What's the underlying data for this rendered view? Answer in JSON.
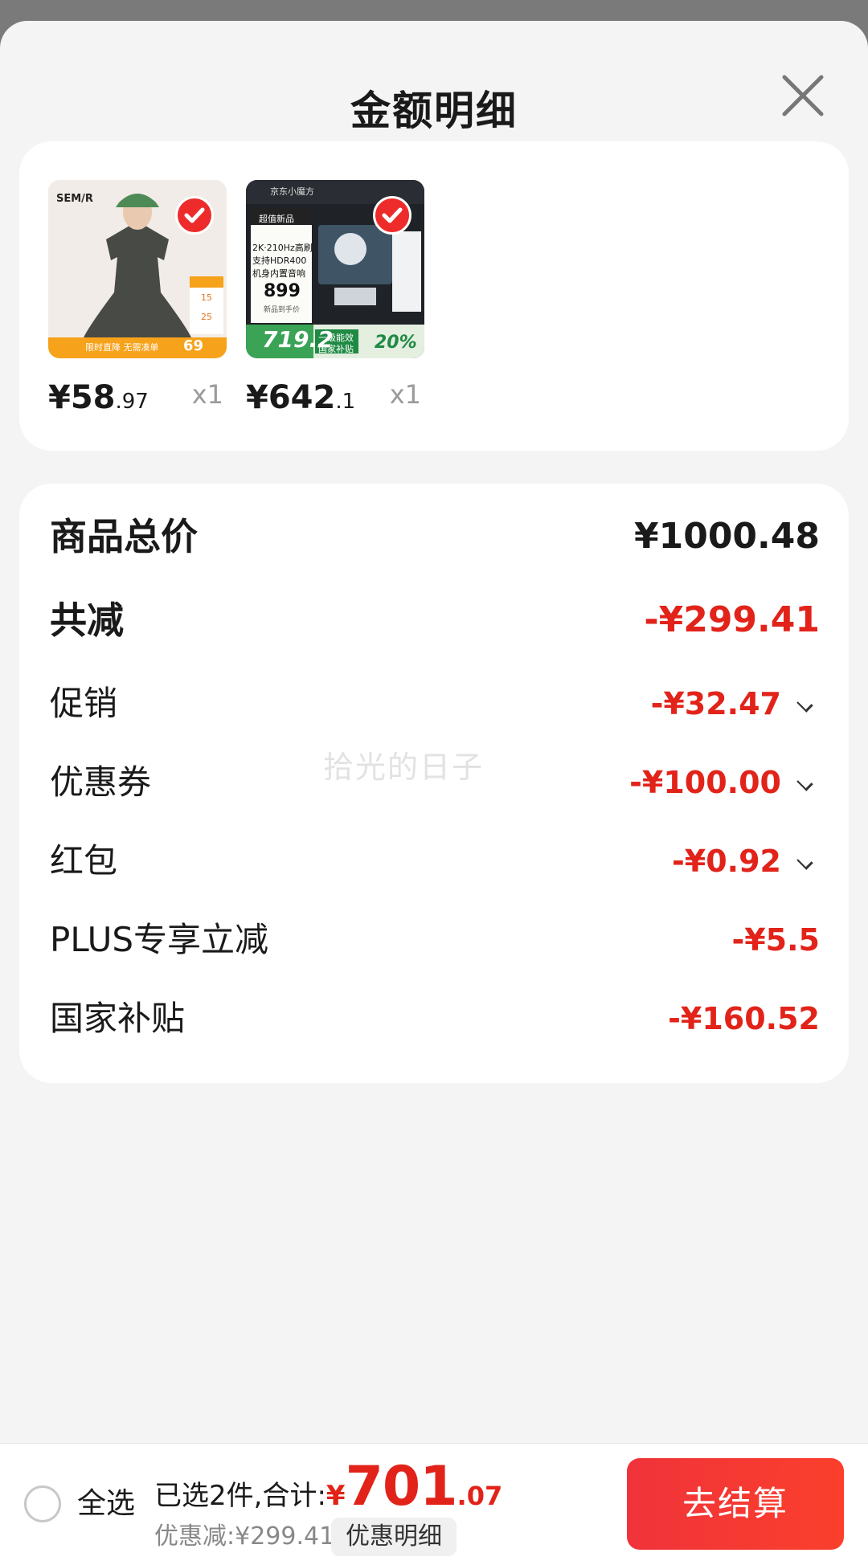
{
  "header": {
    "title": "金额明细",
    "close_icon": "close-icon"
  },
  "products": [
    {
      "name": "dress",
      "price_main": "¥58",
      "price_cents": ".97",
      "qty": "x1",
      "selected": true,
      "image": {
        "brand": "SEM/R",
        "strip_text": "限时直降 无需凑单",
        "strip_number": "69",
        "side_a": "15",
        "side_b": "25"
      }
    },
    {
      "name": "monitor",
      "price_main": "¥642",
      "price_cents": ".1",
      "qty": "x1",
      "selected": true,
      "image": {
        "brand": "京东小魔方",
        "tag": "超值新品",
        "spec1": "2K·210Hz高刷",
        "spec2": "支持HDR400",
        "spec3": "机身内置音响",
        "price_label": "899",
        "price_sub": "新品到手价",
        "big_price": "719.2",
        "badge_top": "一级能效",
        "badge_bottom": "国家补贴",
        "percent": "20%"
      }
    }
  ],
  "summary": {
    "total_label": "商品总价",
    "total_value": "¥1000.48",
    "reduce_label": "共减",
    "reduce_value": "-¥299.41",
    "items": [
      {
        "label": "促销",
        "value": "-¥32.47",
        "expandable": true
      },
      {
        "label": "优惠券",
        "value": "-¥100.00",
        "expandable": true
      },
      {
        "label": "红包",
        "value": "-¥0.92",
        "expandable": true
      },
      {
        "label": "PLUS专享立减",
        "value": "-¥5.5",
        "expandable": false
      },
      {
        "label": "国家补贴",
        "value": "-¥160.52",
        "expandable": false
      }
    ]
  },
  "watermark": "拾光的日子",
  "bottom_bar": {
    "select_all": "全选",
    "selected_text": "已选2件,合计:",
    "currency": "¥",
    "total_int": "701",
    "total_dec": ".07",
    "discount_text": "优惠减:¥299.41",
    "detail_button": "优惠明细",
    "checkout_button": "去结算"
  },
  "colors": {
    "accent": "#e2231a",
    "checkout": "#f0333a",
    "background": "#f4f4f4"
  }
}
